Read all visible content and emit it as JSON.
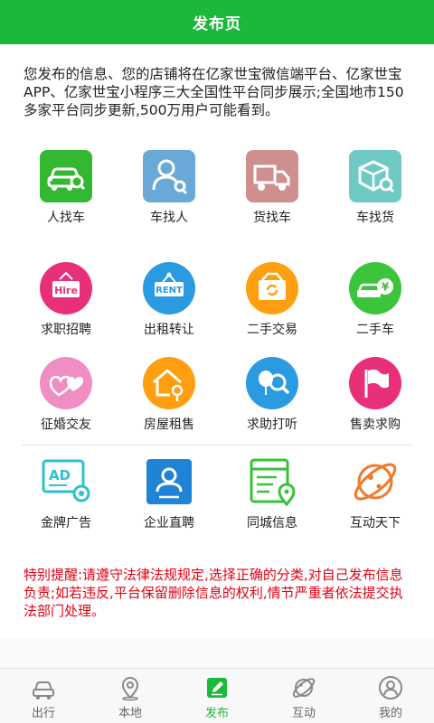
{
  "header": {
    "title": "发布页"
  },
  "intro": {
    "text": "您发布的信息、您的店铺将在亿家世宝微信端平台、亿家世宝APP、亿家世宝小程序三大全国性平台同步展示;全国地市150多家平台同步更新,500万用户可能看到。"
  },
  "row1": [
    {
      "label": "人找车",
      "icon": "car-search-icon",
      "color": "#33b832"
    },
    {
      "label": "车找人",
      "icon": "person-search-icon",
      "color": "#6aa8d8"
    },
    {
      "label": "货找车",
      "icon": "truck-icon",
      "color": "#cf8f8f"
    },
    {
      "label": "车找货",
      "icon": "package-search-icon",
      "color": "#6fcac6"
    }
  ],
  "row2": [
    {
      "label": "求职招聘",
      "icon": "hire-sign-icon",
      "color": "#e8307a"
    },
    {
      "label": "出租转让",
      "icon": "rent-sign-icon",
      "color": "#2a9be0"
    },
    {
      "label": "二手交易",
      "icon": "exchange-box-icon",
      "color": "#ff9f10"
    },
    {
      "label": "二手车",
      "icon": "used-car-icon",
      "color": "#3cc43a"
    },
    {
      "label": "",
      "icon": "",
      "color": ""
    }
  ],
  "row3": [
    {
      "label": "征婚交友",
      "icon": "hearts-icon",
      "color": "#f08ec4"
    },
    {
      "label": "房屋租售",
      "icon": "house-key-icon",
      "color": "#ff9f10"
    },
    {
      "label": "求助打听",
      "icon": "balloon-search-icon",
      "color": "#2a9be0"
    },
    {
      "label": "售卖求购",
      "icon": "flag-icon",
      "color": "#e8307a"
    }
  ],
  "row4": [
    {
      "label": "金牌广告",
      "icon": "ad-board-icon",
      "color": "#2fc0cf"
    },
    {
      "label": "企业直聘",
      "icon": "id-card-icon",
      "color": "#1f84d6"
    },
    {
      "label": "同城信息",
      "icon": "web-location-icon",
      "color": "#38c23a"
    },
    {
      "label": "互动天下",
      "icon": "planet-icon",
      "color": "#f07a2a"
    }
  ],
  "notice": {
    "text": "特别提醒:请遵守法律法规规定,选择正确的分类,对自己发布信息负责;如若违反,平台保留删除信息的权利,情节严重者依法提交执法部门处理。"
  },
  "tabs": [
    {
      "label": "出行",
      "icon": "car-outline-icon",
      "active": false
    },
    {
      "label": "本地",
      "icon": "location-pin-icon",
      "active": false
    },
    {
      "label": "发布",
      "icon": "edit-icon",
      "active": true
    },
    {
      "label": "互动",
      "icon": "planet-outline-icon",
      "active": false
    },
    {
      "label": "我的",
      "icon": "user-icon",
      "active": false
    }
  ],
  "colors": {
    "brand": "#1bb83c",
    "notice": "#e60012"
  }
}
